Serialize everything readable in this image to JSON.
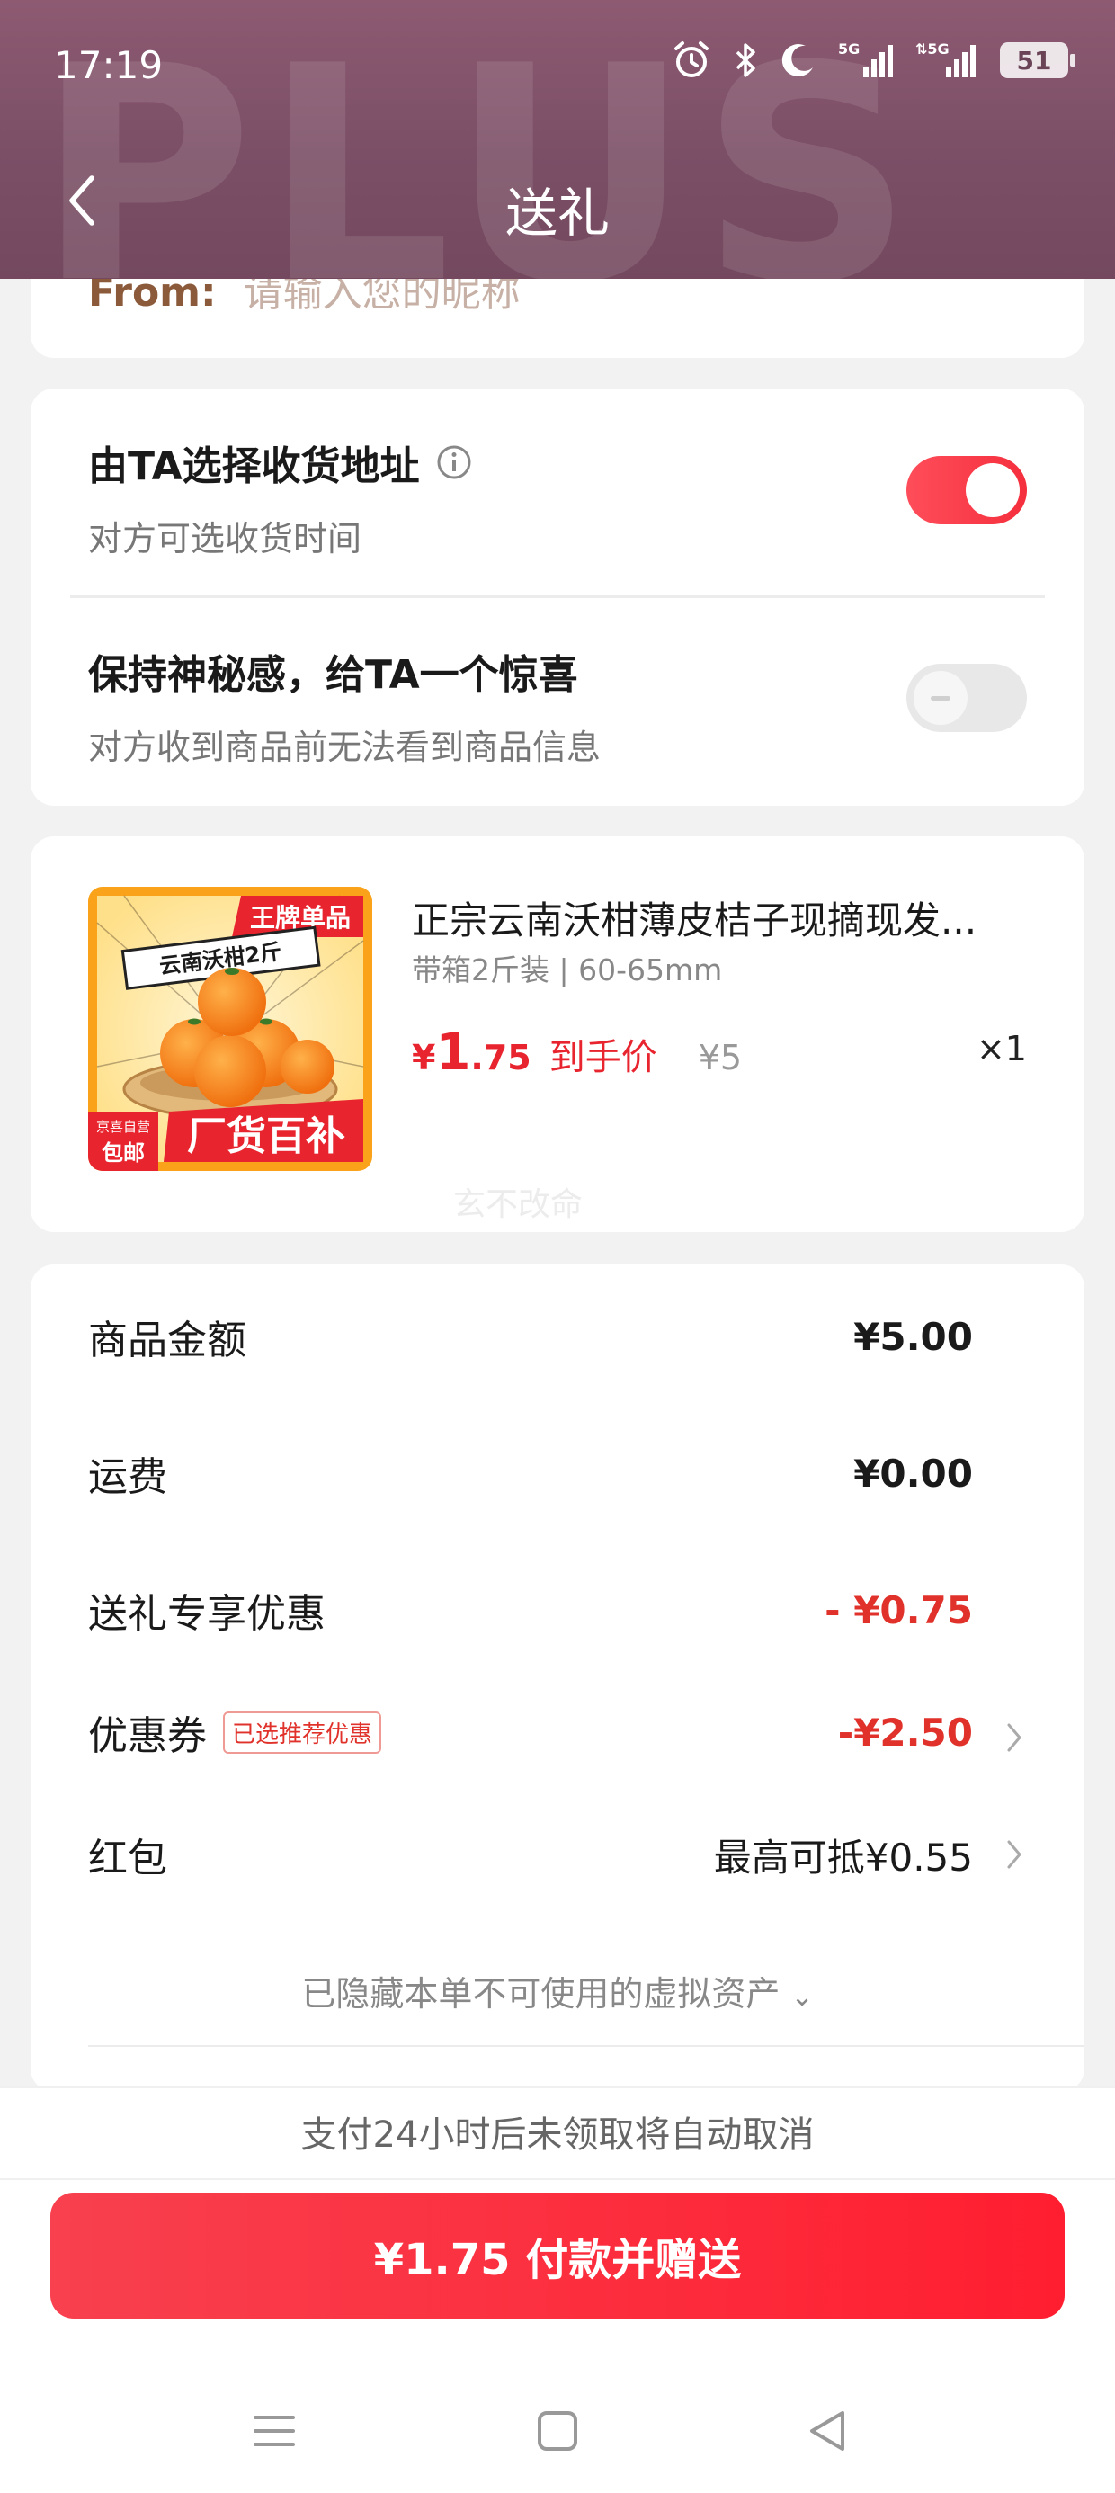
{
  "status_bar": {
    "time": "17:19",
    "battery": "51"
  },
  "header": {
    "title": "送礼",
    "watermark": "PLUS"
  },
  "from": {
    "label": "From:",
    "placeholder": "请输入您的昵称"
  },
  "options": {
    "address": {
      "title": "由TA选择收货地址",
      "subtitle": "对方可选收货时间",
      "enabled": true
    },
    "mystery": {
      "title": "保持神秘感，给TA一个惊喜",
      "subtitle": "对方收到商品前无法看到商品信息",
      "enabled": false
    }
  },
  "product": {
    "title": "正宗云南沃柑薄皮桔子现摘现发...",
    "spec": "带箱2斤装 | 60-65mm",
    "price_yen": "¥",
    "price_int": "1",
    "price_dec": ".75",
    "price_tag": "到手价",
    "original_price": "¥5",
    "quantity": "×1",
    "image_texts": {
      "top_banner": "王牌单品",
      "sub_banner": "云南沃柑2斤",
      "badge_top": "京喜自营",
      "badge_bottom": "包邮",
      "bottom_banner": "厂货百补"
    },
    "watermark": "玄不改命"
  },
  "summary": {
    "rows": [
      {
        "label": "商品金额",
        "value": "¥5.00"
      },
      {
        "label": "运费",
        "value": "¥0.00"
      },
      {
        "label": "送礼专享优惠",
        "value": "- ¥0.75"
      },
      {
        "label": "优惠券",
        "badge": "已选推荐优惠",
        "value": "-¥2.50"
      },
      {
        "label": "红包",
        "value": "最高可抵¥0.55"
      }
    ],
    "hidden_assets": "已隐藏本单不可使用的虚拟资产"
  },
  "notice": "支付24小时后未领取将自动取消",
  "pay_button": "¥1.75 付款并赠送",
  "colors": {
    "accent_red": "#e8242e",
    "header_bg": "#7b4f66",
    "from_label": "#8b5a3a"
  }
}
